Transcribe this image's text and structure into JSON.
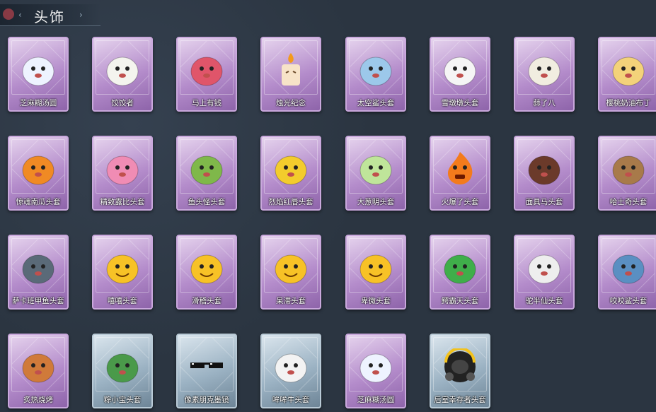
{
  "header": {
    "title": "头饰"
  },
  "items": [
    {
      "label": "芝麻糊汤圆",
      "icon": "rice-ball-icon",
      "color": "#eef3ff",
      "frame": "purple"
    },
    {
      "label": "饺饺者",
      "icon": "dumpling-icon",
      "color": "#f4f4ee",
      "frame": "purple"
    },
    {
      "label": "马上有钱",
      "icon": "horse-icon",
      "color": "#e0556a",
      "frame": "purple"
    },
    {
      "label": "烛光纪念",
      "icon": "candle-icon",
      "color": "#f7e3c8",
      "frame": "purple"
    },
    {
      "label": "太空鲨头套",
      "icon": "space-shark-icon",
      "color": "#9cc8ea",
      "frame": "purple"
    },
    {
      "label": "雪墩墩头套",
      "icon": "snowman-icon",
      "color": "#f5f5f5",
      "frame": "purple"
    },
    {
      "label": "蒜了八",
      "icon": "garlic-icon",
      "color": "#f1ede0",
      "frame": "purple"
    },
    {
      "label": "樱桃奶油布丁",
      "icon": "pudding-icon",
      "color": "#f3d27a",
      "frame": "purple"
    },
    {
      "label": "惊魂南瓜头套",
      "icon": "pumpkin-icon",
      "color": "#f08a24",
      "frame": "purple"
    },
    {
      "label": "精致露比头套",
      "icon": "pink-pig-icon",
      "color": "#f08cb4",
      "frame": "purple"
    },
    {
      "label": "鱼头怪头套",
      "icon": "fish-head-icon",
      "color": "#7fb84a",
      "frame": "purple"
    },
    {
      "label": "烈焰红唇头套",
      "icon": "pikachu-icon",
      "color": "#f3cc2c",
      "frame": "purple"
    },
    {
      "label": "大葱明头套",
      "icon": "scallion-icon",
      "color": "#bfe59a",
      "frame": "purple"
    },
    {
      "label": "火爆了头套",
      "icon": "fire-icon",
      "color": "#f37b1c",
      "frame": "purple"
    },
    {
      "label": "面具马头套",
      "icon": "horse-mask-icon",
      "color": "#6b3a2a",
      "frame": "purple"
    },
    {
      "label": "哈士奇头套",
      "icon": "dog-icon",
      "color": "#a87a4a",
      "frame": "purple"
    },
    {
      "label": "萨卡班甲鱼头套",
      "icon": "fish-icon",
      "color": "#5a6a78",
      "frame": "purple"
    },
    {
      "label": "嘻嘻头套",
      "icon": "grin-emoji-icon",
      "color": "#f7c226",
      "frame": "purple"
    },
    {
      "label": "滑稽头套",
      "icon": "smirk-emoji-icon",
      "color": "#f7c226",
      "frame": "purple"
    },
    {
      "label": "呆滞头套",
      "icon": "stare-emoji-icon",
      "color": "#f7c226",
      "frame": "purple"
    },
    {
      "label": "卑微头套",
      "icon": "shy-emoji-icon",
      "color": "#f7c226",
      "frame": "purple"
    },
    {
      "label": "鳄霸天头套",
      "icon": "crocodile-icon",
      "color": "#3fae4a",
      "frame": "purple"
    },
    {
      "label": "驼半仙头套",
      "icon": "alpaca-icon",
      "color": "#eeeeee",
      "frame": "purple"
    },
    {
      "label": "咬咬鲨头套",
      "icon": "shark-icon",
      "color": "#5a8fc2",
      "frame": "purple"
    },
    {
      "label": "炙热烧烤",
      "icon": "grill-icon",
      "color": "#d07a3a",
      "frame": "purple"
    },
    {
      "label": "粽小宝头套",
      "icon": "zongzi-icon",
      "color": "#4a9a4a",
      "frame": "blue"
    },
    {
      "label": "像素朋克墨镜",
      "icon": "pixel-sunglasses-icon",
      "color": "#111111",
      "frame": "blue"
    },
    {
      "label": "哞哞牛头套",
      "icon": "cow-icon",
      "color": "#f3f3f3",
      "frame": "blue"
    },
    {
      "label": "芝麻糊汤圆",
      "icon": "rice-ball-icon",
      "color": "#eef3ff",
      "frame": "purple"
    },
    {
      "label": "后室幸存者头套",
      "icon": "gas-mask-icon",
      "color": "#2a2a2a",
      "frame": "blue"
    }
  ]
}
